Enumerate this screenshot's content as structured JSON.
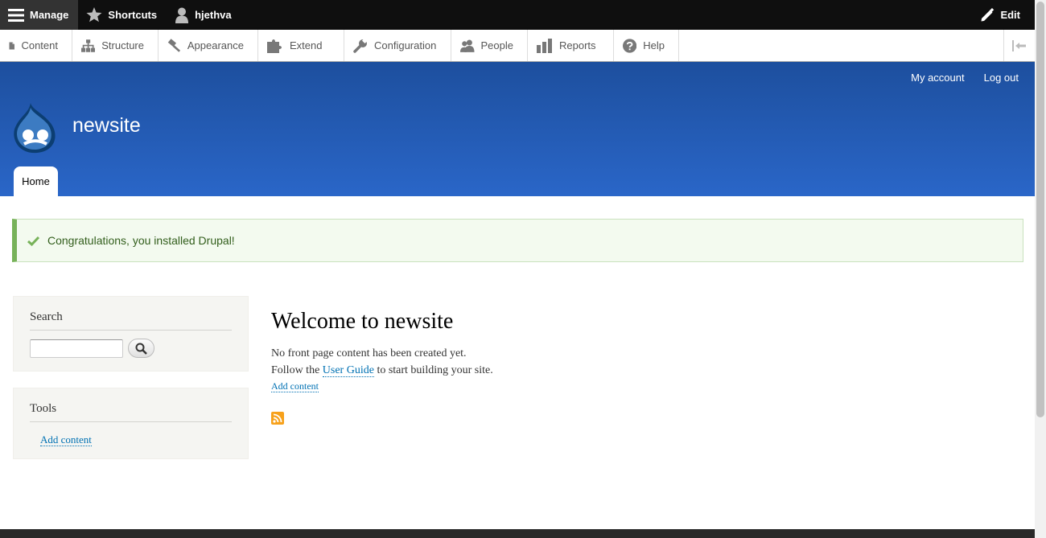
{
  "toolbar": {
    "manage": "Manage",
    "shortcuts": "Shortcuts",
    "user": "hjethva",
    "edit": "Edit"
  },
  "tray": {
    "items": [
      "Content",
      "Structure",
      "Appearance",
      "Extend",
      "Configuration",
      "People",
      "Reports",
      "Help"
    ]
  },
  "header": {
    "site_name": "newsite",
    "my_account": "My account",
    "log_out": "Log out",
    "home_tab": "Home"
  },
  "message": {
    "text": "Congratulations, you installed Drupal!",
    "color": "#77b259"
  },
  "sidebar": {
    "search_title": "Search",
    "search_value": "",
    "tools_title": "Tools",
    "tools_link": "Add content"
  },
  "main": {
    "title": "Welcome to newsite",
    "line1": "No front page content has been created yet.",
    "line2_prefix": "Follow the",
    "line2_link": "User Guide",
    "line2_suffix": "to start building your site.",
    "add_content": "Add content"
  },
  "colors": {
    "header_top": "#1d4f9e",
    "header_bottom": "#2a66c8",
    "link": "#0071b3",
    "rss": "#f7a11b"
  }
}
